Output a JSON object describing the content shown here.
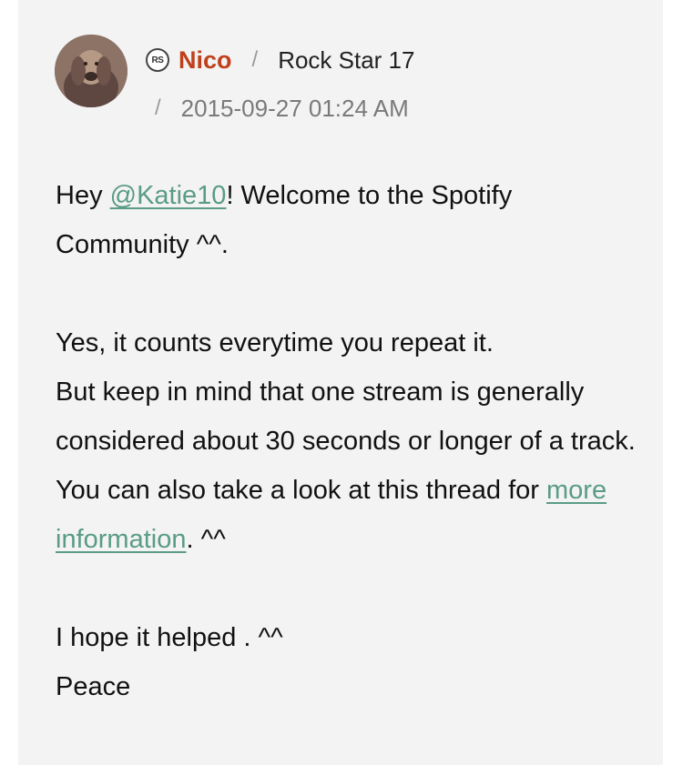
{
  "post": {
    "author": {
      "name": "Nico",
      "rank_badge": "RS",
      "rank_badge_icon": "rank-badge-icon",
      "rank": "Rock Star 17",
      "separator": "/"
    },
    "timestamp_separator": "/",
    "timestamp": "2015-09-27 01:24 AM",
    "body": {
      "line1_prefix": "Hey ",
      "mention": "@Katie10",
      "line1_suffix": "! Welcome to the Spotify Community ^^.",
      "p2_line1": "Yes, it counts everytime you repeat it.",
      "p2_line2": "But keep in mind that one stream is generally considered about 30 seconds or longer of a track.",
      "p2_line3": "You can also take a look at this thread for ",
      "more_info_link": "more information",
      "p2_line3_suffix": ". ^^",
      "p3_line1": "I hope it helped . ^^",
      "p3_line2": "Peace"
    }
  },
  "colors": {
    "panel_bg": "#f3f3f3",
    "username": "#c0401b",
    "link": "#5a9c84",
    "meta_text": "#7a7a7a"
  }
}
